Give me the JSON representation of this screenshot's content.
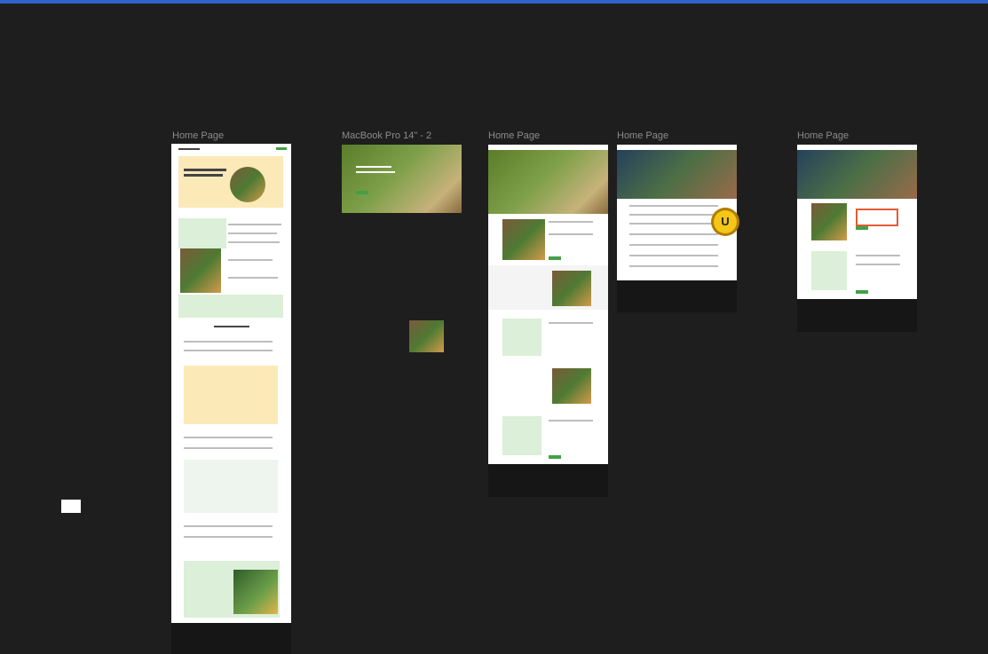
{
  "canvas": {
    "background_color": "#1e1e1e",
    "selection_color": "#2f63c9",
    "frames": [
      {
        "label": "Home Page"
      },
      {
        "label": "MacBook Pro 14\" - 2"
      },
      {
        "label": "Home Page"
      },
      {
        "label": "Home Page"
      },
      {
        "label": "Home Page"
      }
    ],
    "avatar_badge": {
      "initial": "U",
      "color": "#f5c518"
    }
  },
  "brand_colors": {
    "accent_green": "#43a047",
    "cream": "#fbe9b8",
    "highlight_red": "#e25b33"
  }
}
